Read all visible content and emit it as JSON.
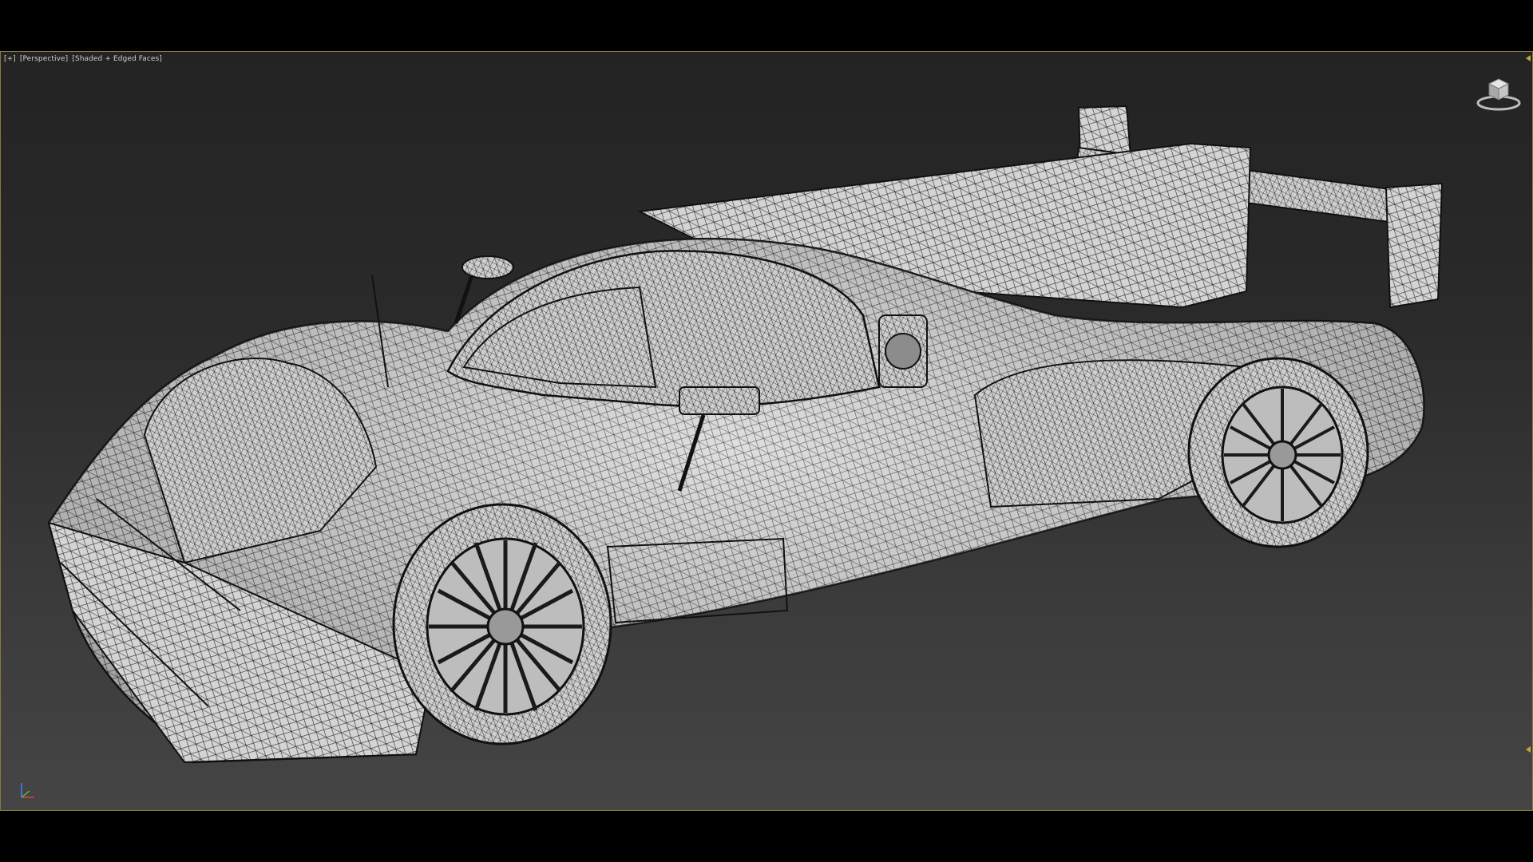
{
  "viewport": {
    "labels": {
      "plus": "[+]",
      "view": "[Perspective]",
      "shading": "[Shaded + Edged Faces]"
    }
  },
  "icons": {
    "viewcube": "viewcube-icon",
    "axis_tripod": "axis-tripod-icon"
  },
  "colors": {
    "border_accent": "#8a7a3a",
    "marker": "#c9a640",
    "mesh_fill": "#d7d7d7",
    "mesh_line": "#1a1a1a"
  }
}
